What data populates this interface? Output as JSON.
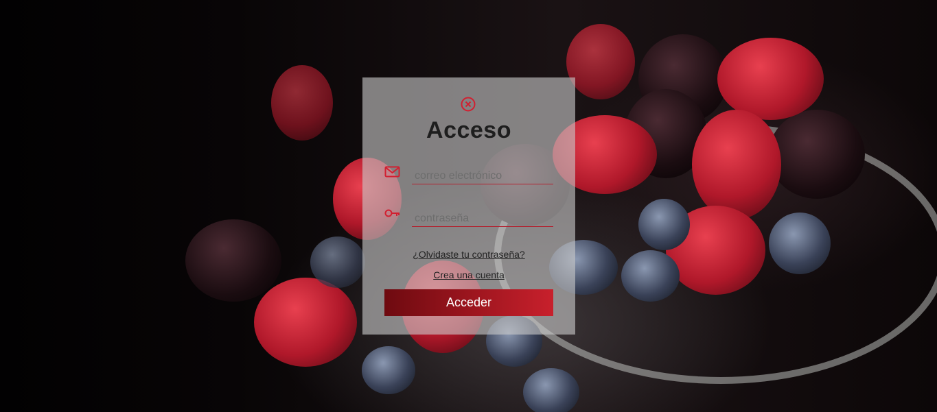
{
  "login": {
    "title": "Acceso",
    "email_placeholder": "correo electrónico",
    "email_value": "",
    "password_placeholder": "contraseña",
    "password_value": "",
    "forgot_link": "¿Olvidaste tu contraseña?",
    "create_account_link": "Crea una cuenta",
    "submit_label": "Acceder"
  },
  "icons": {
    "close": "close-circle-icon",
    "email": "envelope-icon",
    "password": "key-icon"
  },
  "colors": {
    "accent": "#d21f30",
    "button_start": "#6e0a10",
    "button_end": "#c8202c"
  }
}
